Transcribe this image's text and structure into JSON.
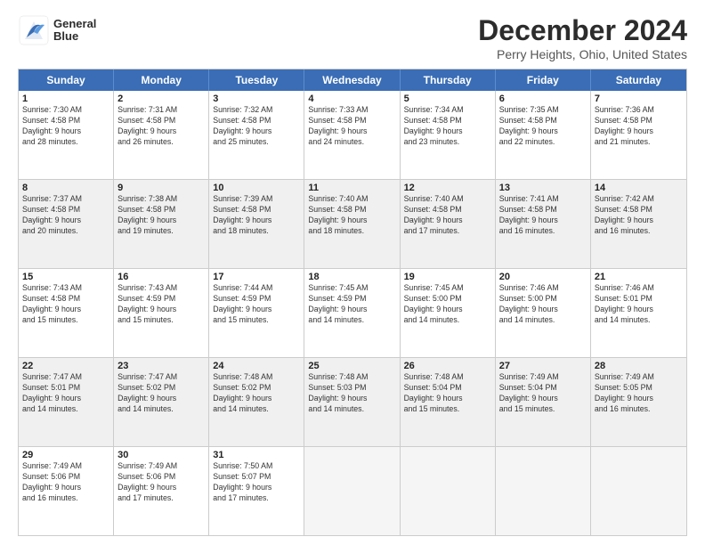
{
  "logo": {
    "line1": "General",
    "line2": "Blue"
  },
  "title": "December 2024",
  "subtitle": "Perry Heights, Ohio, United States",
  "header_days": [
    "Sunday",
    "Monday",
    "Tuesday",
    "Wednesday",
    "Thursday",
    "Friday",
    "Saturday"
  ],
  "rows": [
    [
      {
        "day": "1",
        "info": "Sunrise: 7:30 AM\nSunset: 4:58 PM\nDaylight: 9 hours\nand 28 minutes."
      },
      {
        "day": "2",
        "info": "Sunrise: 7:31 AM\nSunset: 4:58 PM\nDaylight: 9 hours\nand 26 minutes."
      },
      {
        "day": "3",
        "info": "Sunrise: 7:32 AM\nSunset: 4:58 PM\nDaylight: 9 hours\nand 25 minutes."
      },
      {
        "day": "4",
        "info": "Sunrise: 7:33 AM\nSunset: 4:58 PM\nDaylight: 9 hours\nand 24 minutes."
      },
      {
        "day": "5",
        "info": "Sunrise: 7:34 AM\nSunset: 4:58 PM\nDaylight: 9 hours\nand 23 minutes."
      },
      {
        "day": "6",
        "info": "Sunrise: 7:35 AM\nSunset: 4:58 PM\nDaylight: 9 hours\nand 22 minutes."
      },
      {
        "day": "7",
        "info": "Sunrise: 7:36 AM\nSunset: 4:58 PM\nDaylight: 9 hours\nand 21 minutes."
      }
    ],
    [
      {
        "day": "8",
        "info": "Sunrise: 7:37 AM\nSunset: 4:58 PM\nDaylight: 9 hours\nand 20 minutes."
      },
      {
        "day": "9",
        "info": "Sunrise: 7:38 AM\nSunset: 4:58 PM\nDaylight: 9 hours\nand 19 minutes."
      },
      {
        "day": "10",
        "info": "Sunrise: 7:39 AM\nSunset: 4:58 PM\nDaylight: 9 hours\nand 18 minutes."
      },
      {
        "day": "11",
        "info": "Sunrise: 7:40 AM\nSunset: 4:58 PM\nDaylight: 9 hours\nand 18 minutes."
      },
      {
        "day": "12",
        "info": "Sunrise: 7:40 AM\nSunset: 4:58 PM\nDaylight: 9 hours\nand 17 minutes."
      },
      {
        "day": "13",
        "info": "Sunrise: 7:41 AM\nSunset: 4:58 PM\nDaylight: 9 hours\nand 16 minutes."
      },
      {
        "day": "14",
        "info": "Sunrise: 7:42 AM\nSunset: 4:58 PM\nDaylight: 9 hours\nand 16 minutes."
      }
    ],
    [
      {
        "day": "15",
        "info": "Sunrise: 7:43 AM\nSunset: 4:58 PM\nDaylight: 9 hours\nand 15 minutes."
      },
      {
        "day": "16",
        "info": "Sunrise: 7:43 AM\nSunset: 4:59 PM\nDaylight: 9 hours\nand 15 minutes."
      },
      {
        "day": "17",
        "info": "Sunrise: 7:44 AM\nSunset: 4:59 PM\nDaylight: 9 hours\nand 15 minutes."
      },
      {
        "day": "18",
        "info": "Sunrise: 7:45 AM\nSunset: 4:59 PM\nDaylight: 9 hours\nand 14 minutes."
      },
      {
        "day": "19",
        "info": "Sunrise: 7:45 AM\nSunset: 5:00 PM\nDaylight: 9 hours\nand 14 minutes."
      },
      {
        "day": "20",
        "info": "Sunrise: 7:46 AM\nSunset: 5:00 PM\nDaylight: 9 hours\nand 14 minutes."
      },
      {
        "day": "21",
        "info": "Sunrise: 7:46 AM\nSunset: 5:01 PM\nDaylight: 9 hours\nand 14 minutes."
      }
    ],
    [
      {
        "day": "22",
        "info": "Sunrise: 7:47 AM\nSunset: 5:01 PM\nDaylight: 9 hours\nand 14 minutes."
      },
      {
        "day": "23",
        "info": "Sunrise: 7:47 AM\nSunset: 5:02 PM\nDaylight: 9 hours\nand 14 minutes."
      },
      {
        "day": "24",
        "info": "Sunrise: 7:48 AM\nSunset: 5:02 PM\nDaylight: 9 hours\nand 14 minutes."
      },
      {
        "day": "25",
        "info": "Sunrise: 7:48 AM\nSunset: 5:03 PM\nDaylight: 9 hours\nand 14 minutes."
      },
      {
        "day": "26",
        "info": "Sunrise: 7:48 AM\nSunset: 5:04 PM\nDaylight: 9 hours\nand 15 minutes."
      },
      {
        "day": "27",
        "info": "Sunrise: 7:49 AM\nSunset: 5:04 PM\nDaylight: 9 hours\nand 15 minutes."
      },
      {
        "day": "28",
        "info": "Sunrise: 7:49 AM\nSunset: 5:05 PM\nDaylight: 9 hours\nand 16 minutes."
      }
    ],
    [
      {
        "day": "29",
        "info": "Sunrise: 7:49 AM\nSunset: 5:06 PM\nDaylight: 9 hours\nand 16 minutes."
      },
      {
        "day": "30",
        "info": "Sunrise: 7:49 AM\nSunset: 5:06 PM\nDaylight: 9 hours\nand 17 minutes."
      },
      {
        "day": "31",
        "info": "Sunrise: 7:50 AM\nSunset: 5:07 PM\nDaylight: 9 hours\nand 17 minutes."
      },
      {
        "day": "",
        "info": ""
      },
      {
        "day": "",
        "info": ""
      },
      {
        "day": "",
        "info": ""
      },
      {
        "day": "",
        "info": ""
      }
    ]
  ]
}
